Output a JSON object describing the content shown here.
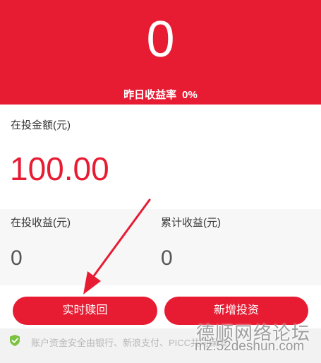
{
  "hero": {
    "value": "0",
    "rate_label": "昨日收益率",
    "rate_value": "0%"
  },
  "invest": {
    "label": "在投金额(元)",
    "value": "100.00"
  },
  "earnings": {
    "current_label": "在投收益(元)",
    "current_value": "0",
    "total_label": "累计收益(元)",
    "total_value": "0"
  },
  "buttons": {
    "redeem_label": "实时赎回",
    "add_label": "新增投资"
  },
  "footer": {
    "security_text": "账户资金安全由银行、新浪支付、PICC共同保障",
    "icon": "shield-check-icon"
  },
  "watermark": {
    "title": "德顺网络论坛",
    "url": "mz.52deshun.com"
  },
  "colors": {
    "brand_red": "#e71c33",
    "shield_green": "#7cc242"
  }
}
